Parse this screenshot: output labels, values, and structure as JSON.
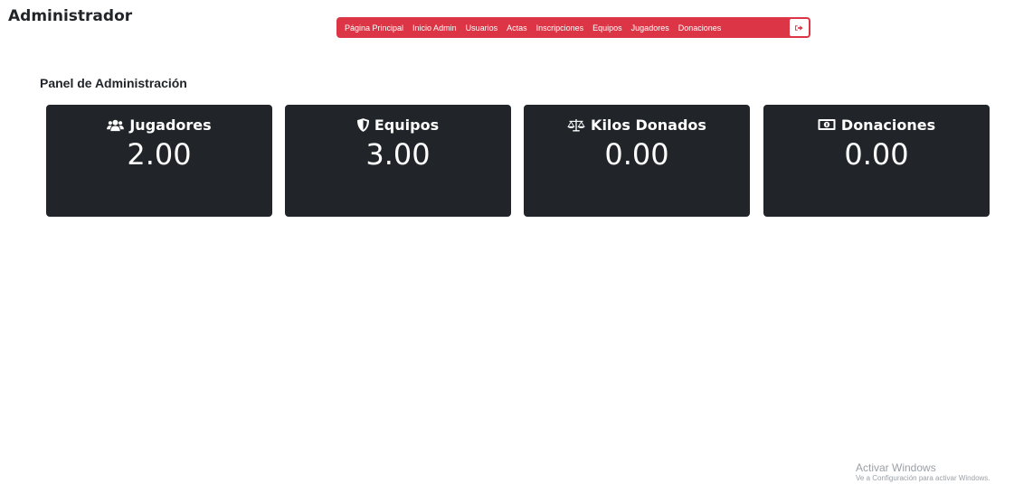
{
  "header": {
    "title": "Administrador"
  },
  "nav": {
    "items": [
      {
        "label": "Página Principal"
      },
      {
        "label": "Inicio Admin"
      },
      {
        "label": "Usuarios"
      },
      {
        "label": "Actas"
      },
      {
        "label": "Inscripciones"
      },
      {
        "label": "Equipos"
      },
      {
        "label": "Jugadores"
      },
      {
        "label": "Donaciones"
      }
    ],
    "logout_icon": "sign-out-icon",
    "color": "#dc3545"
  },
  "panel": {
    "title": "Panel de Administración"
  },
  "cards": [
    {
      "icon": "users-icon",
      "label": "Jugadores",
      "value": "2.00"
    },
    {
      "icon": "shield-icon",
      "label": "Equipos",
      "value": "3.00"
    },
    {
      "icon": "scale-icon",
      "label": "Kilos Donados",
      "value": "0.00"
    },
    {
      "icon": "money-bill-icon",
      "label": "Donaciones",
      "value": "0.00"
    }
  ],
  "card_color": "#212529",
  "watermark": {
    "title": "Activar Windows",
    "subtitle": "Ve a Configuración para activar Windows."
  }
}
